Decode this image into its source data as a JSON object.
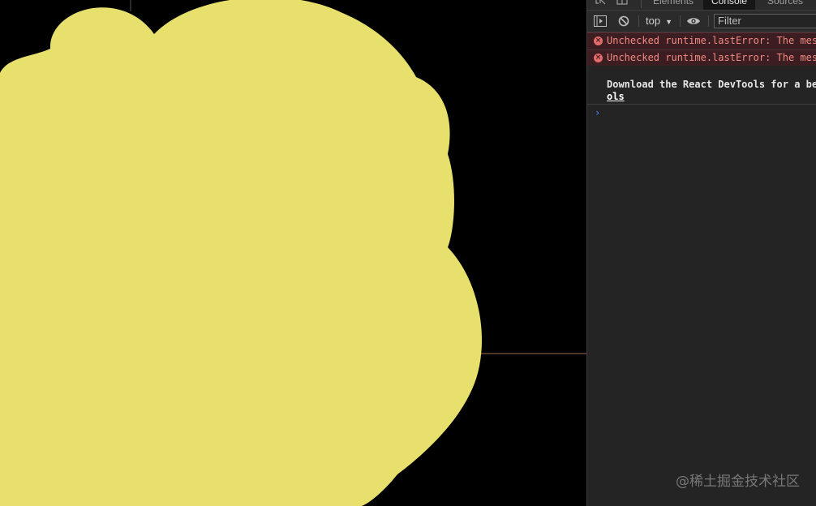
{
  "devtools": {
    "tabs": [
      {
        "label": "Elements"
      },
      {
        "label": "Console"
      },
      {
        "label": "Sources"
      }
    ],
    "toolbar": {
      "context": "top",
      "filter_placeholder": "Filter"
    },
    "console": {
      "errors": [
        {
          "text": "Unchecked runtime.lastError: The mes"
        },
        {
          "text": "Unchecked runtime.lastError: The mes"
        }
      ],
      "log": {
        "line1": "Download the React DevTools for a be",
        "line2": "ols"
      },
      "prompt_symbol": "›"
    }
  },
  "canvas": {
    "blob_color": "#E8E06C",
    "background_color": "#000000"
  },
  "watermark": "@稀土掘金技术社区"
}
